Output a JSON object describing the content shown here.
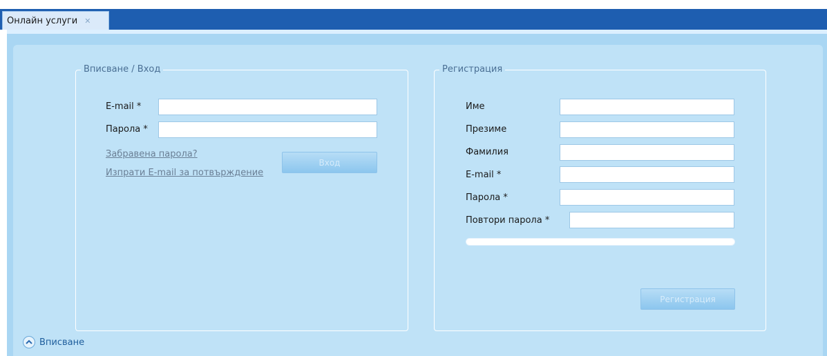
{
  "tab": {
    "label": "Онлайн услуги",
    "close_glyph": "✕"
  },
  "login": {
    "legend": "Вписване / Вход",
    "email_label": "E-mail *",
    "password_label": "Парола *",
    "email_value": "",
    "password_value": "",
    "forgot_link": "Забравена парола?",
    "resend_link": "Изпрати E-mail за потвърждение",
    "submit_label": "Вход"
  },
  "register": {
    "legend": "Регистрация",
    "first_name_label": "Име",
    "middle_name_label": "Презиме",
    "last_name_label": "Фамилия",
    "email_label": "E-mail *",
    "password_label": "Парола *",
    "repeat_password_label": "Повтори парола *",
    "submit_label": "Регистрация"
  },
  "footer": {
    "toggle_label": "Вписване",
    "icon": "chevron-up-icon"
  },
  "colors": {
    "tabbar": "#1e5eb0",
    "panel": "#bfe2f7",
    "accent": "#1f5e9c"
  }
}
